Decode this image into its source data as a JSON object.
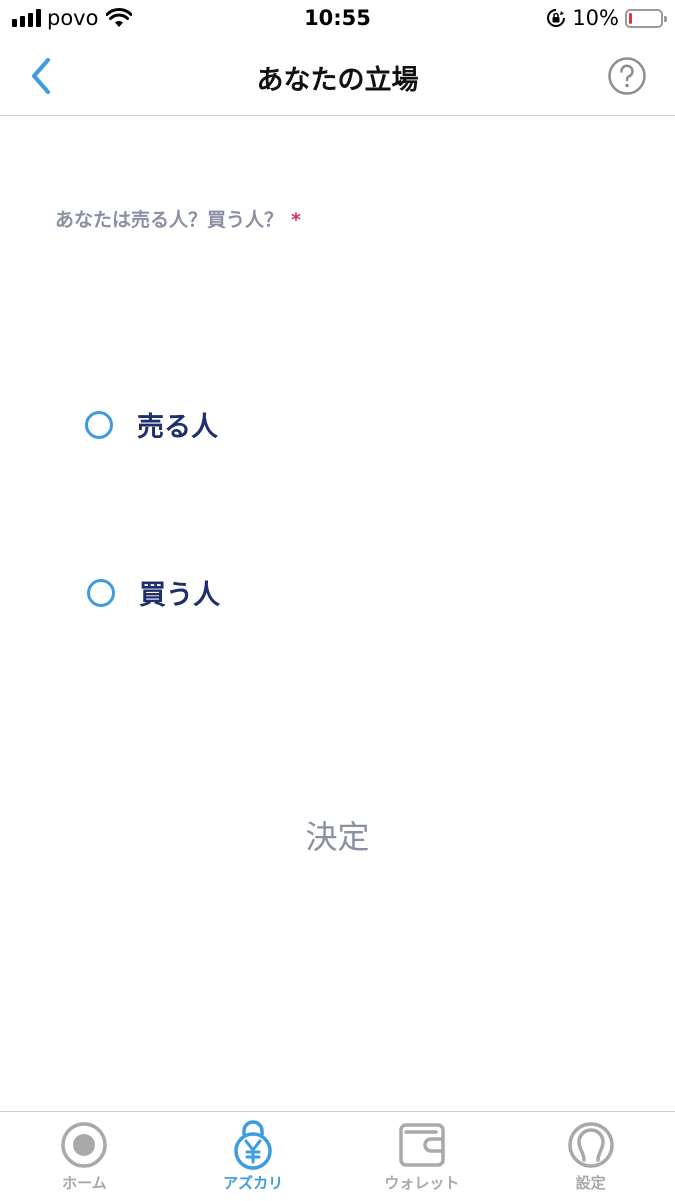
{
  "status_bar": {
    "carrier": "povo",
    "time": "10:55",
    "battery": "10%",
    "battery_level": 0.1,
    "battery_color": "#e0363a"
  },
  "nav": {
    "title": "あなたの立場",
    "back_icon": "chevron-left-icon",
    "help_icon": "question-circle-icon"
  },
  "form": {
    "question": "あなたは売る人？買う人？",
    "required_mark": "*",
    "options": [
      {
        "label": "売る人",
        "selected": false
      },
      {
        "label": "買う人",
        "selected": false
      }
    ],
    "submit_label": "決定"
  },
  "tab_bar": {
    "active_color": "#3d9be0",
    "inactive_color": "#a9a9a9",
    "tabs": [
      {
        "label": "ホーム",
        "icon": "home-record-icon",
        "active": false
      },
      {
        "label": "アズカリ",
        "icon": "yen-lock-icon",
        "active": true
      },
      {
        "label": "ウォレット",
        "icon": "wallet-icon",
        "active": false
      },
      {
        "label": "設定",
        "icon": "settings-person-icon",
        "active": false
      }
    ]
  }
}
